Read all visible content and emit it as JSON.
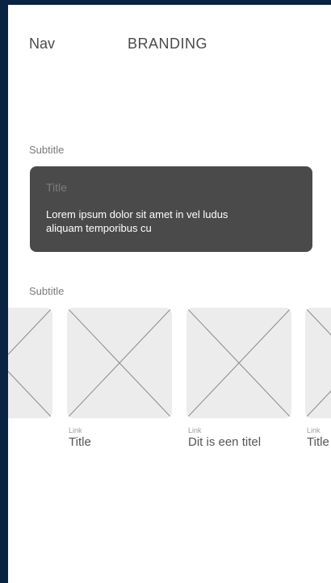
{
  "header": {
    "nav_label": "Nav",
    "brand": "BRANDING"
  },
  "section1": {
    "subtitle": "Subtitle",
    "card": {
      "title": "Title",
      "body": "Lorem ipsum dolor sit amet in vel ludus aliquam temporibus cu"
    }
  },
  "section2": {
    "subtitle": "Subtitle",
    "items": [
      {
        "link": "",
        "title": ""
      },
      {
        "link": "Link",
        "title": "Title"
      },
      {
        "link": "Link",
        "title": "Dit is een titel"
      },
      {
        "link": "Link",
        "title": "Title"
      }
    ]
  },
  "colors": {
    "frame": "#0a2342",
    "card_bg": "#4a4a4a",
    "placeholder_bg": "#ececec"
  }
}
